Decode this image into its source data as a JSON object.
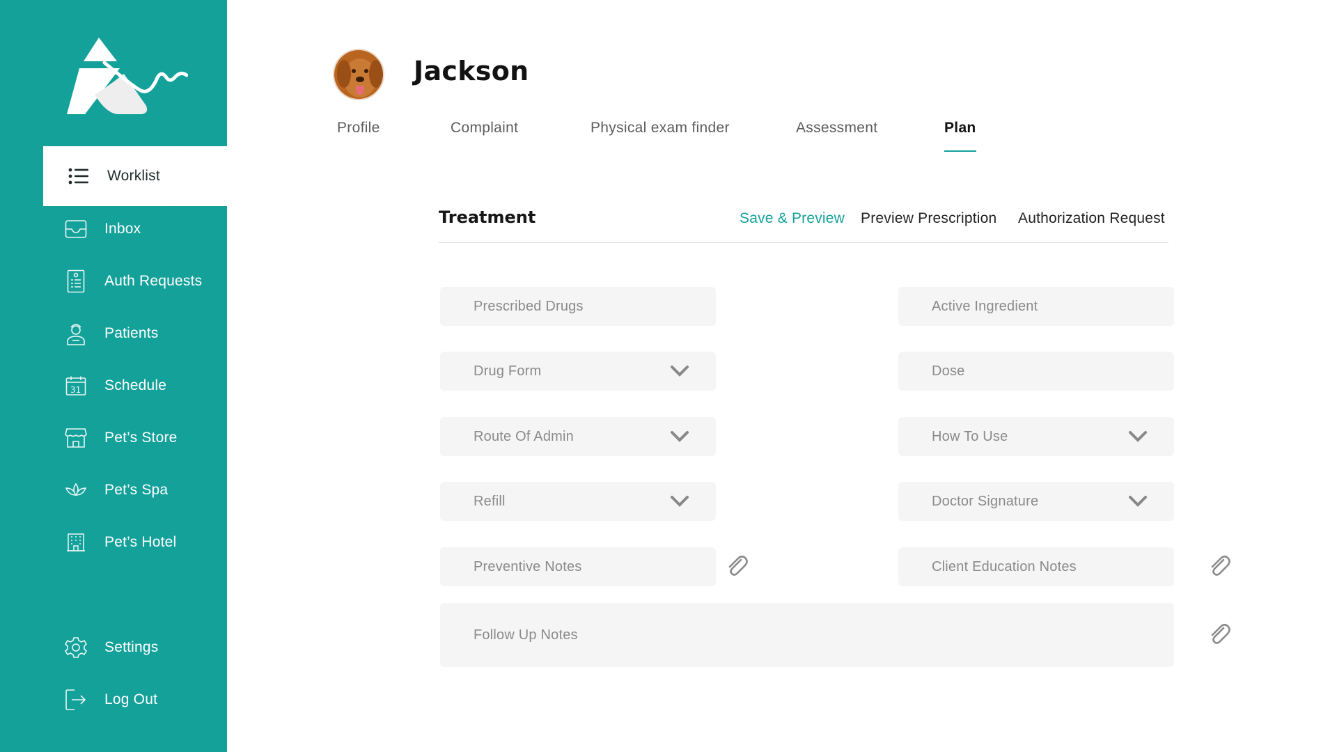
{
  "sidebar": {
    "brand_color": "#14a19a",
    "items": [
      {
        "label": "Worklist",
        "icon": "list-icon",
        "active": true
      },
      {
        "label": "Inbox",
        "icon": "inbox-icon"
      },
      {
        "label": "Auth Requests",
        "icon": "document-icon"
      },
      {
        "label": "Patients",
        "icon": "patient-icon"
      },
      {
        "label": "Schedule",
        "icon": "calendar-icon"
      },
      {
        "label": "Pet’s Store",
        "icon": "store-icon"
      },
      {
        "label": "Pet’s Spa",
        "icon": "lotus-icon"
      },
      {
        "label": "Pet’s Hotel",
        "icon": "hotel-icon"
      }
    ],
    "bottom_items": [
      {
        "label": "Settings",
        "icon": "gear-icon"
      },
      {
        "label": "Log Out",
        "icon": "logout-icon"
      }
    ]
  },
  "header": {
    "patient_name": "Jackson",
    "avatar": "dog-avatar"
  },
  "tabs": [
    {
      "label": "Profile"
    },
    {
      "label": "Complaint"
    },
    {
      "label": "Physical exam finder"
    },
    {
      "label": "Assessment"
    },
    {
      "label": "Plan",
      "active": true
    }
  ],
  "treatment": {
    "title": "Treatment",
    "actions": {
      "save_preview": "Save & Preview",
      "preview_prescription": "Preview Prescription",
      "authorization_request": "Authorization Request"
    },
    "fields": {
      "prescribed_drugs": "Prescribed Drugs",
      "active_ingredient": "Active Ingredient",
      "drug_form": "Drug Form",
      "dose": "Dose",
      "route_of_admin": "Route Of Admin",
      "how_to_use": "How To Use",
      "refill": "Refill",
      "doctor_signature": "Doctor Signature",
      "preventive_notes": "Preventive Notes",
      "client_education_notes": "Client Education Notes",
      "follow_up_notes": "Follow Up Notes"
    }
  }
}
